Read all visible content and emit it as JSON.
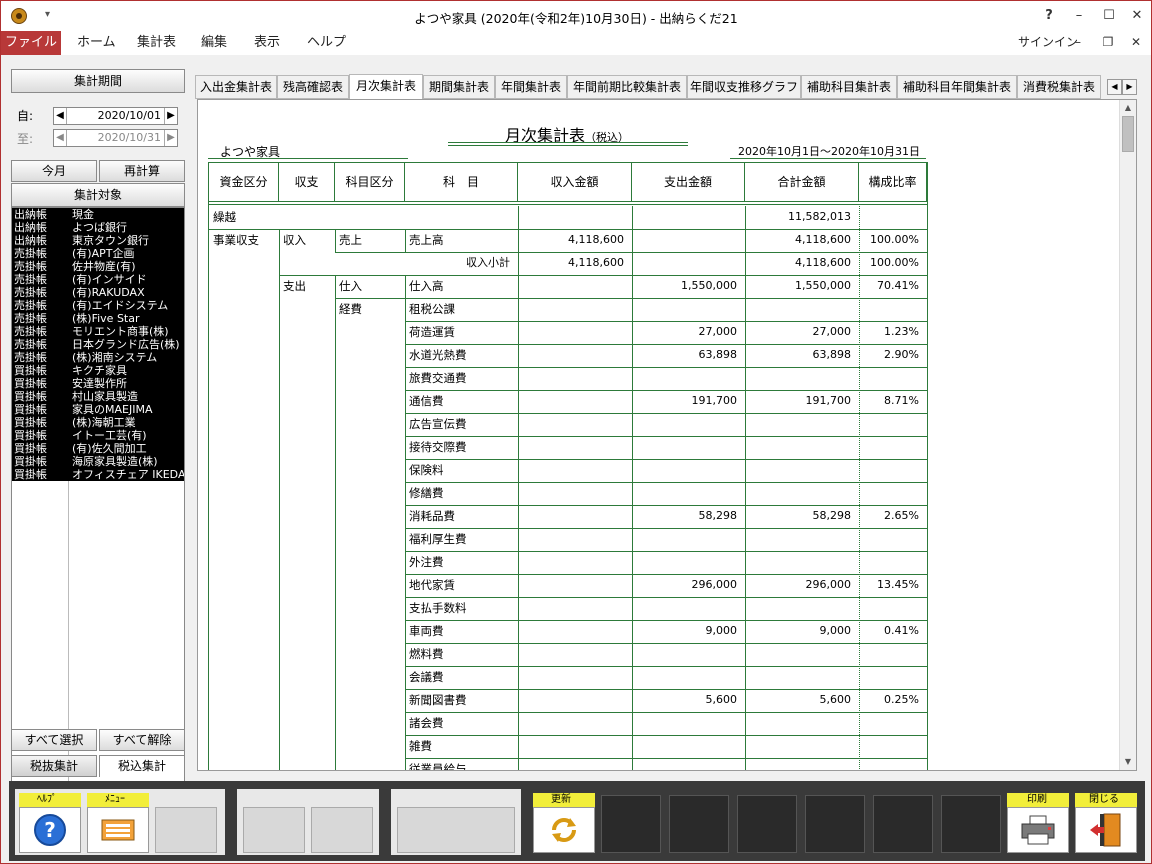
{
  "window": {
    "title": "よつや家具 (2020年(令和2年)10月30日) - 出納らくだ21",
    "help_label": "?",
    "minimize": "–",
    "maximize": "☐",
    "close": "✕"
  },
  "menu": {
    "items": [
      "ファイル",
      "ホーム",
      "集計表",
      "編集",
      "表示",
      "ヘルプ"
    ],
    "signin": "サインイン",
    "mini_min": "–",
    "mini_restore": "❐",
    "mini_close": "✕"
  },
  "left": {
    "period_header": "集計期間",
    "from_label": "自:",
    "from_date": "2020/10/01",
    "to_label": "至:",
    "to_date": "2020/10/31",
    "this_month": "今月",
    "recalc": "再計算",
    "target_header": "集計対象",
    "targets": [
      {
        "kind": "出納帳",
        "name": "現金"
      },
      {
        "kind": "出納帳",
        "name": "よつば銀行"
      },
      {
        "kind": "出納帳",
        "name": "東京タウン銀行"
      },
      {
        "kind": "売掛帳",
        "name": "(有)APT企画"
      },
      {
        "kind": "売掛帳",
        "name": "佐井物産(有)"
      },
      {
        "kind": "売掛帳",
        "name": "(有)インサイド"
      },
      {
        "kind": "売掛帳",
        "name": "(有)RAKUDAX"
      },
      {
        "kind": "売掛帳",
        "name": "(有)エイドシステム"
      },
      {
        "kind": "売掛帳",
        "name": "(株)Five Star"
      },
      {
        "kind": "売掛帳",
        "name": "モリエント商事(株)"
      },
      {
        "kind": "売掛帳",
        "name": "日本グランド広告(株)"
      },
      {
        "kind": "売掛帳",
        "name": "(株)湘南システム"
      },
      {
        "kind": "買掛帳",
        "name": "キクチ家具"
      },
      {
        "kind": "買掛帳",
        "name": "安達製作所"
      },
      {
        "kind": "買掛帳",
        "name": "村山家具製造"
      },
      {
        "kind": "買掛帳",
        "name": "家具のMAEJIMA"
      },
      {
        "kind": "買掛帳",
        "name": "(株)海朝工業"
      },
      {
        "kind": "買掛帳",
        "name": "イトー工芸(有)"
      },
      {
        "kind": "買掛帳",
        "name": "(有)佐久間加工"
      },
      {
        "kind": "買掛帳",
        "name": "海原家具製造(株)"
      },
      {
        "kind": "買掛帳",
        "name": "オフィスチェア IKEDA"
      }
    ],
    "select_all": "すべて選択",
    "deselect_all": "すべて解除",
    "tax_excluded": "税抜集計",
    "tax_included": "税込集計"
  },
  "tabs": [
    "入出金集計表",
    "残高確認表",
    "月次集計表",
    "期間集計表",
    "年間集計表",
    "年間前期比較集計表",
    "年間収支推移グラフ",
    "補助科目集計表",
    "補助科目年間集計表",
    "消費税集計表"
  ],
  "tab_arrow_left": "◀",
  "tab_arrow_right": "▶",
  "report": {
    "title": "月次集計表",
    "title_note": "（税込）",
    "company": "よつや家具",
    "period": "2020年10月1日～2020年10月31日",
    "headers": [
      "資金区分",
      "収支",
      "科目区分",
      "科　目",
      "収入金額",
      "支出金額",
      "合計金額",
      "構成比率"
    ],
    "carry_label": "繰越",
    "carry_total": "11,582,013",
    "section_business": "事業収支",
    "income_label": "収入",
    "expense_label": "支出",
    "sales_cat": "売上",
    "sales_item": "売上高",
    "sales_income": "4,118,600",
    "sales_total": "4,118,600",
    "sales_ratio": "100.00%",
    "income_subtotal_label": "収入小計",
    "income_subtotal": "4,118,600",
    "income_subtotal_total": "4,118,600",
    "income_subtotal_ratio": "100.00%",
    "purchase_cat": "仕入",
    "expense_cat": "経費",
    "rows": [
      {
        "item": "仕入高",
        "expense": "1,550,000",
        "total": "1,550,000",
        "ratio": "70.41%"
      },
      {
        "item": "租税公課",
        "expense": "",
        "total": "",
        "ratio": ""
      },
      {
        "item": "荷造運賃",
        "expense": "27,000",
        "total": "27,000",
        "ratio": "1.23%"
      },
      {
        "item": "水道光熱費",
        "expense": "63,898",
        "total": "63,898",
        "ratio": "2.90%"
      },
      {
        "item": "旅費交通費",
        "expense": "",
        "total": "",
        "ratio": ""
      },
      {
        "item": "通信費",
        "expense": "191,700",
        "total": "191,700",
        "ratio": "8.71%"
      },
      {
        "item": "広告宣伝費",
        "expense": "",
        "total": "",
        "ratio": ""
      },
      {
        "item": "接待交際費",
        "expense": "",
        "total": "",
        "ratio": ""
      },
      {
        "item": "保険料",
        "expense": "",
        "total": "",
        "ratio": ""
      },
      {
        "item": "修繕費",
        "expense": "",
        "total": "",
        "ratio": ""
      },
      {
        "item": "消耗品費",
        "expense": "58,298",
        "total": "58,298",
        "ratio": "2.65%"
      },
      {
        "item": "福利厚生費",
        "expense": "",
        "total": "",
        "ratio": ""
      },
      {
        "item": "外注費",
        "expense": "",
        "total": "",
        "ratio": ""
      },
      {
        "item": "地代家賃",
        "expense": "296,000",
        "total": "296,000",
        "ratio": "13.45%"
      },
      {
        "item": "支払手数料",
        "expense": "",
        "total": "",
        "ratio": ""
      },
      {
        "item": "車両費",
        "expense": "9,000",
        "total": "9,000",
        "ratio": "0.41%"
      },
      {
        "item": "燃料費",
        "expense": "",
        "total": "",
        "ratio": ""
      },
      {
        "item": "会議費",
        "expense": "",
        "total": "",
        "ratio": ""
      },
      {
        "item": "新聞図書費",
        "expense": "5,600",
        "total": "5,600",
        "ratio": "0.25%"
      },
      {
        "item": "諸会費",
        "expense": "",
        "total": "",
        "ratio": ""
      },
      {
        "item": "雑費",
        "expense": "",
        "total": "",
        "ratio": ""
      },
      {
        "item": "従業員給与",
        "expense": "",
        "total": "",
        "ratio": ""
      }
    ]
  },
  "fkeys": {
    "help": "ﾍﾙﾌﾟ",
    "menu": "ﾒﾆｭｰ",
    "refresh": "更新",
    "print": "印刷",
    "close": "閉じる"
  },
  "colors": {
    "accent": "#b83838",
    "grid": "#2d7a3a",
    "fkey_label": "#f2ee3a"
  }
}
